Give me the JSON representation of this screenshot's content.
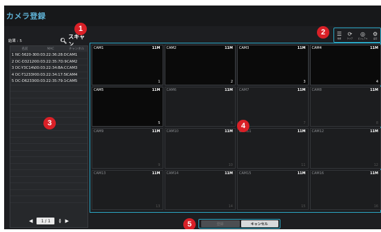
{
  "window": {
    "title": "カメラ登録"
  },
  "scan": {
    "result_label": "結果 : 5",
    "scan_label": "スキャン"
  },
  "list": {
    "headers": [
      "名前",
      "MAC",
      "チャンネル"
    ],
    "rows": [
      {
        "n": "1",
        "name": "NC-5620-3Z",
        "mac": "00:03:22:36:28:D5",
        "ch": "CAM1"
      },
      {
        "n": "2",
        "name": "DC-D3212RX",
        "mac": "00:03:22:35:7D:9D",
        "ch": "CAM2"
      },
      {
        "n": "3",
        "name": "DC-Y3C14WR",
        "mac": "00:03:22:34:BA:CC",
        "ch": "CAM3"
      },
      {
        "n": "4",
        "name": "DC-T1233HR",
        "mac": "00:03:22:34:17:5F",
        "ch": "CAM4"
      },
      {
        "n": "5",
        "name": "DC-D6233HR",
        "mac": "00:03:22:35:79:14",
        "ch": "CAM5"
      }
    ]
  },
  "pager": {
    "page": "1 / 1"
  },
  "toolbar": {
    "items": [
      {
        "icon": "list-icon",
        "label": "種類"
      },
      {
        "icon": "refresh-icon",
        "label": "クリア"
      },
      {
        "icon": "reset-icon",
        "label": "ビジュアル"
      },
      {
        "icon": "gear-icon",
        "label": "設定"
      }
    ]
  },
  "grid": {
    "cells": [
      {
        "name": "CAM1",
        "res": "11M",
        "index": "1",
        "active": true
      },
      {
        "name": "CAM2",
        "res": "11M",
        "index": "2",
        "active": true
      },
      {
        "name": "CAM3",
        "res": "11M",
        "index": "3",
        "active": true
      },
      {
        "name": "CAM4",
        "res": "11M",
        "index": "4",
        "active": true
      },
      {
        "name": "CAM5",
        "res": "11M",
        "index": "5",
        "active": true
      },
      {
        "name": "CAM6",
        "res": "11M",
        "index": "6",
        "active": false
      },
      {
        "name": "CAM7",
        "res": "11M",
        "index": "7",
        "active": false
      },
      {
        "name": "CAM8",
        "res": "11M",
        "index": "8",
        "active": false
      },
      {
        "name": "CAM9",
        "res": "11M",
        "index": "9",
        "active": false
      },
      {
        "name": "CAM10",
        "res": "11M",
        "index": "10",
        "active": false
      },
      {
        "name": "CAM11",
        "res": "11M",
        "index": "11",
        "active": false
      },
      {
        "name": "CAM12",
        "res": "11M",
        "index": "12",
        "active": false
      },
      {
        "name": "CAM13",
        "res": "11M",
        "index": "13",
        "active": false
      },
      {
        "name": "CAM14",
        "res": "11M",
        "index": "14",
        "active": false
      },
      {
        "name": "CAM15",
        "res": "11M",
        "index": "15",
        "active": false
      },
      {
        "name": "CAM16",
        "res": "11M",
        "index": "16",
        "active": false
      }
    ]
  },
  "actions": {
    "ok_label": "登録",
    "cancel_label": "キャンセル"
  },
  "callouts": [
    "1",
    "2",
    "3",
    "4",
    "5"
  ],
  "colors": {
    "accent": "#2aa9c7",
    "title": "#5fb2d6",
    "callout": "#d92027"
  }
}
